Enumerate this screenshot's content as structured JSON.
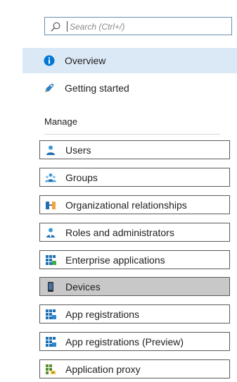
{
  "search": {
    "placeholder": "Search (Ctrl+/)",
    "icon": "search-icon"
  },
  "nav": [
    {
      "label": "Overview",
      "icon": "info-icon",
      "active": true
    },
    {
      "label": "Getting started",
      "icon": "rocket-icon",
      "active": false
    }
  ],
  "section": {
    "title": "Manage"
  },
  "manage_items": [
    {
      "label": "Users",
      "icon": "user-icon"
    },
    {
      "label": "Groups",
      "icon": "group-icon"
    },
    {
      "label": "Organizational relationships",
      "icon": "org-relationships-icon"
    },
    {
      "label": "Roles and administrators",
      "icon": "roles-icon"
    },
    {
      "label": "Enterprise applications",
      "icon": "enterprise-apps-icon"
    },
    {
      "label": "Devices",
      "icon": "device-icon",
      "selected": true
    },
    {
      "label": "App registrations",
      "icon": "app-registrations-icon"
    },
    {
      "label": "App registrations (Preview)",
      "icon": "app-registrations-preview-icon"
    },
    {
      "label": "Application proxy",
      "icon": "app-proxy-icon"
    }
  ],
  "colors": {
    "accent": "#0078d4",
    "active_bg": "#dbe9f6",
    "selected_bg": "#c8c8c8",
    "border": "#5a5a5a"
  }
}
